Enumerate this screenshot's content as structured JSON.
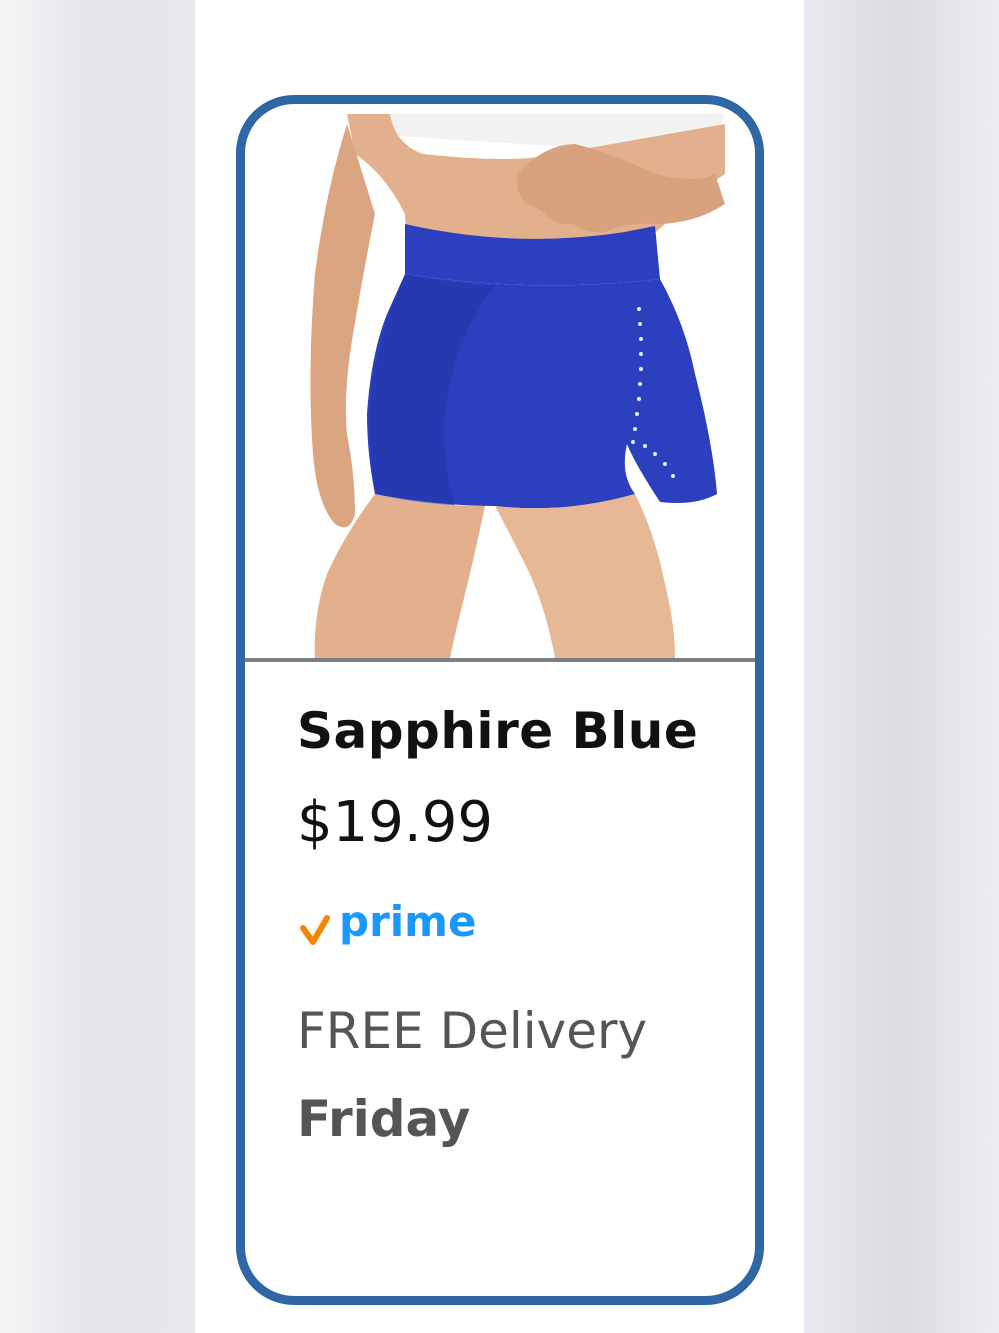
{
  "swatch": {
    "color_name": "Sapphire Blue",
    "price": "$19.99",
    "badge": {
      "icon": "prime-check-icon",
      "label": "prime"
    },
    "delivery": {
      "line": "FREE Delivery",
      "day": "Friday"
    },
    "image_icon": "shorts-product-image"
  },
  "colors": {
    "card_border": "#2f66a4",
    "prime_blue": "#1a98ff",
    "prime_check": "#f08804",
    "product_blue": "#2b3fbf"
  }
}
